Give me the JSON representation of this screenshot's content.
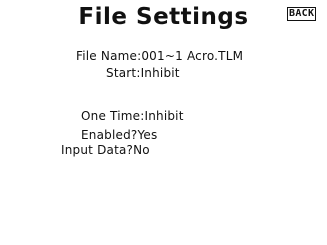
{
  "header": {
    "title": "File Settings",
    "back_label": "BACK"
  },
  "file_name": {
    "label": "File Name:",
    "value": "001~1 Acro.TLM"
  },
  "start": {
    "label": "Start:",
    "value": "Inhibit"
  },
  "one_time": {
    "label": "One Time:",
    "value": "Inhibit"
  },
  "enabled": {
    "label": "Enabled?",
    "value": "Yes"
  },
  "input_data": {
    "label": "Input Data?",
    "value": "No"
  },
  "colors": {
    "background": "#ffffff",
    "text": "#111111"
  }
}
